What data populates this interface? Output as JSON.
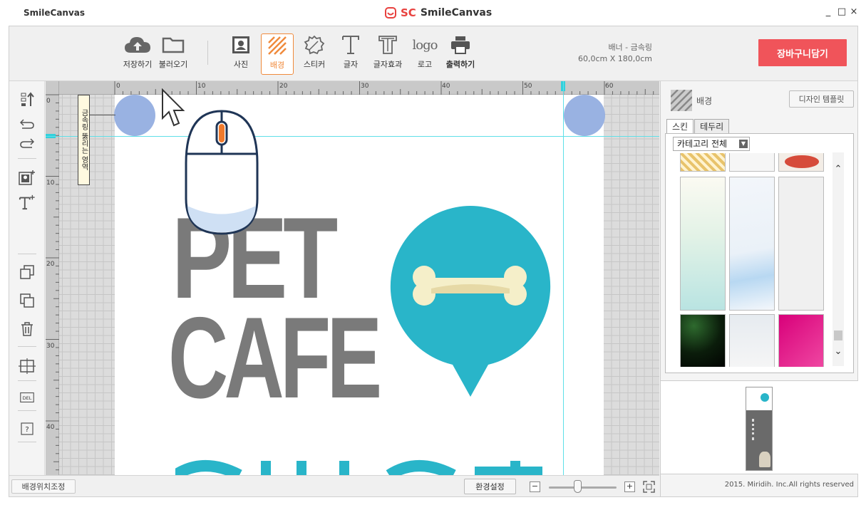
{
  "app": {
    "name": "SmileCanvas",
    "brand_logo": "SC",
    "brand_name": "SmileCanvas",
    "window_controls": [
      "_",
      "□",
      "×"
    ]
  },
  "toolbar": {
    "tools": [
      {
        "id": "save",
        "label": "저장하기",
        "icon": "cloud-upload-icon"
      },
      {
        "id": "load",
        "label": "불러오기",
        "icon": "folder-icon"
      },
      {
        "id": "photo",
        "label": "사진",
        "icon": "photo-icon"
      },
      {
        "id": "background",
        "label": "배경",
        "icon": "background-icon",
        "active": true
      },
      {
        "id": "sticker",
        "label": "스티커",
        "icon": "sticker-icon"
      },
      {
        "id": "text",
        "label": "글자",
        "icon": "text-icon"
      },
      {
        "id": "text_effect",
        "label": "글자효과",
        "icon": "text-effect-icon"
      },
      {
        "id": "logo",
        "label": "로고",
        "icon": "logo-icon"
      },
      {
        "id": "print",
        "label": "출력하기",
        "icon": "printer-icon"
      }
    ],
    "product_name": "배너 - 금속링",
    "product_size": "60,0cm X 180,0cm",
    "cart_button": "장바구니담기",
    "accent_color": "#f08a3c",
    "cart_color": "#f0545a"
  },
  "left_tools": [
    "layer-order-icon",
    "undo-icon",
    "redo-icon",
    "add-photo-icon",
    "add-text-icon",
    "duplicate-icon",
    "group-icon",
    "trash-icon",
    "grid-icon",
    "delete-box-icon",
    "help-icon"
  ],
  "ruler": {
    "h_labels": [
      "0",
      "10",
      "20",
      "30",
      "40",
      "50",
      "60"
    ],
    "v_labels": [
      "0",
      "10",
      "20",
      "30",
      "40"
    ]
  },
  "canvas": {
    "ring_label": "금속링 뚫리는 영역",
    "headline_1": "PET",
    "headline_2": "CAFE",
    "text_color": "#7a7a7a",
    "accent_color": "#29b5c9",
    "hole_color": "#94aee0"
  },
  "bottombar": {
    "bg_position_button": "배경위치조정",
    "settings_button": "환경설정",
    "zoom_out": "−",
    "zoom_in": "+",
    "zoom_level": 0.45
  },
  "right_panel": {
    "title": "배경",
    "template_button": "디자인 템플릿",
    "tabs": [
      "스킨",
      "테두리"
    ],
    "active_tab": "스킨",
    "category_select": "카테고리 전체",
    "copyright": "2015. Miridih. Inc.All rights reserved"
  }
}
